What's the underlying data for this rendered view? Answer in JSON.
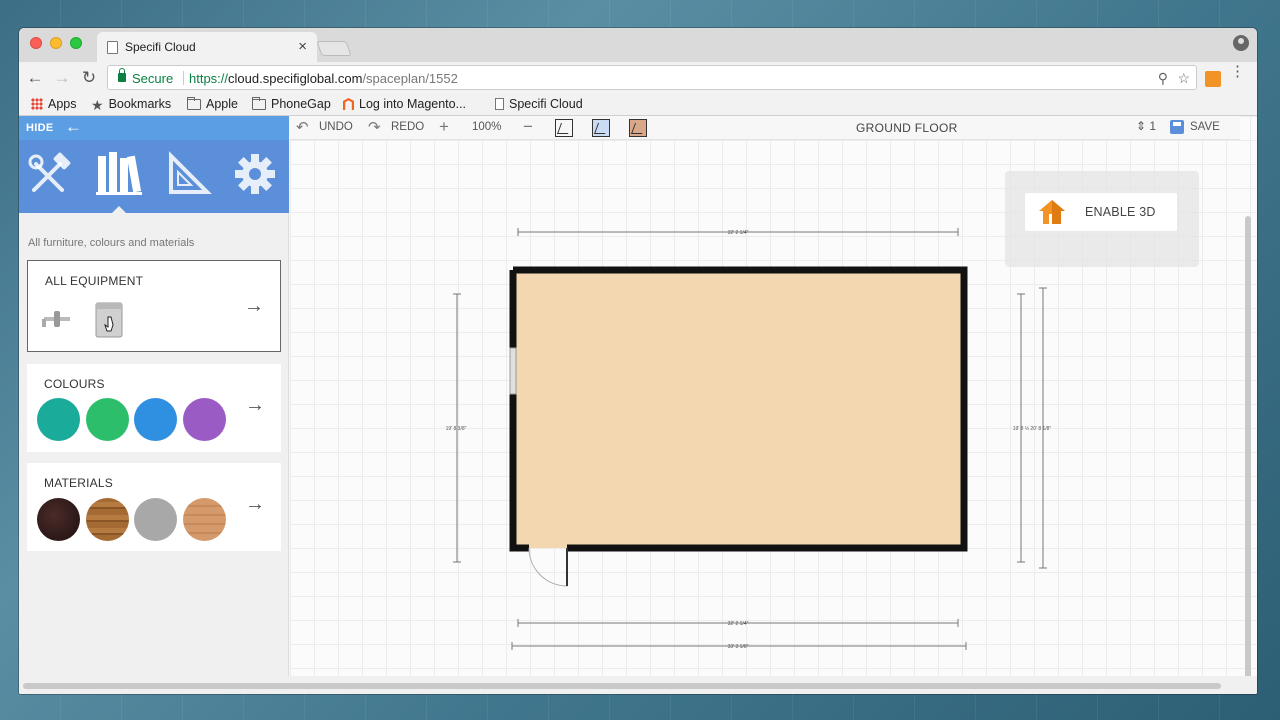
{
  "browser": {
    "tab_title": "Specifi Cloud",
    "tab_close": "×",
    "secure_label": "Secure",
    "url_protocol": "https://",
    "url_host": "cloud.specifiglobal.com",
    "url_path": "/spaceplan/1552",
    "back": "←",
    "forward": "→",
    "reload": "↻",
    "bookmark_star": "☆",
    "key_icon": "⚲",
    "menu": "⋮"
  },
  "bookmarks": [
    {
      "label": "Apps",
      "icon": "grid-icon"
    },
    {
      "label": "Bookmarks",
      "icon": "star-icon"
    },
    {
      "label": "Apple",
      "icon": "folder-icon"
    },
    {
      "label": "PhoneGap",
      "icon": "folder-icon"
    },
    {
      "label": "Log into Magento...",
      "icon": "magento-icon"
    },
    {
      "label": "Specifi Cloud",
      "icon": "page-icon"
    }
  ],
  "sidebar": {
    "hide_label": "HIDE",
    "hide_arrow": "←",
    "tabs": [
      "tools-icon",
      "library-icon",
      "set-square-icon",
      "gear-icon"
    ],
    "active_tab": "library-icon",
    "caption": "All furniture, colours and materials",
    "cards": {
      "equipment": {
        "title": "ALL EQUIPMENT",
        "arrow": "→"
      },
      "colours": {
        "title": "COLOURS",
        "arrow": "→",
        "swatches": [
          "#1aab9b",
          "#2dbe6c",
          "#2f8fe0",
          "#9b5bc4"
        ]
      },
      "materials": {
        "title": "MATERIALS",
        "arrow": "→",
        "swatches": [
          "#2e1a19",
          "#a46a34",
          "#a8a8a8",
          "#d49a6b"
        ]
      }
    }
  },
  "toolbar": {
    "undo_label": "UNDO",
    "redo_label": "REDO",
    "zoom_in": "+",
    "zoom_level": "100%",
    "zoom_out": "−",
    "undo_icon": "↶",
    "redo_icon": "↷",
    "floor_name": "GROUND FLOOR",
    "floor_stepper": "⇕ 1",
    "save_label": "SAVE"
  },
  "enable3d": {
    "label": "ENABLE 3D"
  },
  "plan": {
    "room_fill": "#f3d7b1",
    "wall_color": "#111111",
    "dimensions": {
      "top": "32' 2 1/4\"",
      "bottom_inner": "32' 2 1/4\"",
      "bottom_outer": "33' 3 1/8\"",
      "left": "19' 8 3/8\"",
      "right": "19' 8 ½ 20' 8 1/8\""
    }
  }
}
